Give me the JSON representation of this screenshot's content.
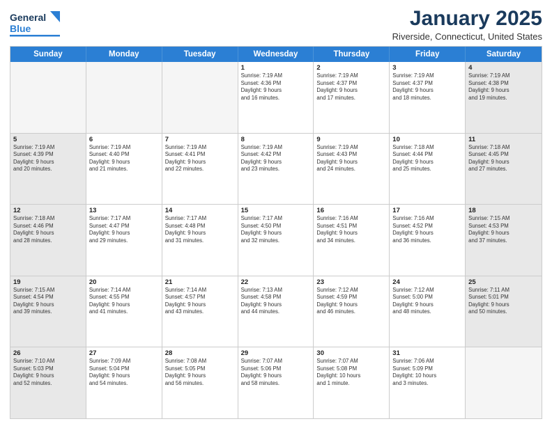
{
  "logo": {
    "line1": "General",
    "line2": "Blue"
  },
  "header": {
    "month": "January 2025",
    "location": "Riverside, Connecticut, United States"
  },
  "weekdays": [
    "Sunday",
    "Monday",
    "Tuesday",
    "Wednesday",
    "Thursday",
    "Friday",
    "Saturday"
  ],
  "weeks": [
    [
      {
        "day": "",
        "info": "",
        "empty": true
      },
      {
        "day": "",
        "info": "",
        "empty": true
      },
      {
        "day": "",
        "info": "",
        "empty": true
      },
      {
        "day": "1",
        "info": "Sunrise: 7:19 AM\nSunset: 4:36 PM\nDaylight: 9 hours\nand 16 minutes."
      },
      {
        "day": "2",
        "info": "Sunrise: 7:19 AM\nSunset: 4:37 PM\nDaylight: 9 hours\nand 17 minutes."
      },
      {
        "day": "3",
        "info": "Sunrise: 7:19 AM\nSunset: 4:37 PM\nDaylight: 9 hours\nand 18 minutes."
      },
      {
        "day": "4",
        "info": "Sunrise: 7:19 AM\nSunset: 4:38 PM\nDaylight: 9 hours\nand 19 minutes.",
        "shaded": true
      }
    ],
    [
      {
        "day": "5",
        "info": "Sunrise: 7:19 AM\nSunset: 4:39 PM\nDaylight: 9 hours\nand 20 minutes.",
        "shaded": true
      },
      {
        "day": "6",
        "info": "Sunrise: 7:19 AM\nSunset: 4:40 PM\nDaylight: 9 hours\nand 21 minutes."
      },
      {
        "day": "7",
        "info": "Sunrise: 7:19 AM\nSunset: 4:41 PM\nDaylight: 9 hours\nand 22 minutes."
      },
      {
        "day": "8",
        "info": "Sunrise: 7:19 AM\nSunset: 4:42 PM\nDaylight: 9 hours\nand 23 minutes."
      },
      {
        "day": "9",
        "info": "Sunrise: 7:19 AM\nSunset: 4:43 PM\nDaylight: 9 hours\nand 24 minutes."
      },
      {
        "day": "10",
        "info": "Sunrise: 7:18 AM\nSunset: 4:44 PM\nDaylight: 9 hours\nand 25 minutes."
      },
      {
        "day": "11",
        "info": "Sunrise: 7:18 AM\nSunset: 4:45 PM\nDaylight: 9 hours\nand 27 minutes.",
        "shaded": true
      }
    ],
    [
      {
        "day": "12",
        "info": "Sunrise: 7:18 AM\nSunset: 4:46 PM\nDaylight: 9 hours\nand 28 minutes.",
        "shaded": true
      },
      {
        "day": "13",
        "info": "Sunrise: 7:17 AM\nSunset: 4:47 PM\nDaylight: 9 hours\nand 29 minutes."
      },
      {
        "day": "14",
        "info": "Sunrise: 7:17 AM\nSunset: 4:48 PM\nDaylight: 9 hours\nand 31 minutes."
      },
      {
        "day": "15",
        "info": "Sunrise: 7:17 AM\nSunset: 4:50 PM\nDaylight: 9 hours\nand 32 minutes."
      },
      {
        "day": "16",
        "info": "Sunrise: 7:16 AM\nSunset: 4:51 PM\nDaylight: 9 hours\nand 34 minutes."
      },
      {
        "day": "17",
        "info": "Sunrise: 7:16 AM\nSunset: 4:52 PM\nDaylight: 9 hours\nand 36 minutes."
      },
      {
        "day": "18",
        "info": "Sunrise: 7:15 AM\nSunset: 4:53 PM\nDaylight: 9 hours\nand 37 minutes.",
        "shaded": true
      }
    ],
    [
      {
        "day": "19",
        "info": "Sunrise: 7:15 AM\nSunset: 4:54 PM\nDaylight: 9 hours\nand 39 minutes.",
        "shaded": true
      },
      {
        "day": "20",
        "info": "Sunrise: 7:14 AM\nSunset: 4:55 PM\nDaylight: 9 hours\nand 41 minutes."
      },
      {
        "day": "21",
        "info": "Sunrise: 7:14 AM\nSunset: 4:57 PM\nDaylight: 9 hours\nand 43 minutes."
      },
      {
        "day": "22",
        "info": "Sunrise: 7:13 AM\nSunset: 4:58 PM\nDaylight: 9 hours\nand 44 minutes."
      },
      {
        "day": "23",
        "info": "Sunrise: 7:12 AM\nSunset: 4:59 PM\nDaylight: 9 hours\nand 46 minutes."
      },
      {
        "day": "24",
        "info": "Sunrise: 7:12 AM\nSunset: 5:00 PM\nDaylight: 9 hours\nand 48 minutes."
      },
      {
        "day": "25",
        "info": "Sunrise: 7:11 AM\nSunset: 5:01 PM\nDaylight: 9 hours\nand 50 minutes.",
        "shaded": true
      }
    ],
    [
      {
        "day": "26",
        "info": "Sunrise: 7:10 AM\nSunset: 5:03 PM\nDaylight: 9 hours\nand 52 minutes.",
        "shaded": true
      },
      {
        "day": "27",
        "info": "Sunrise: 7:09 AM\nSunset: 5:04 PM\nDaylight: 9 hours\nand 54 minutes."
      },
      {
        "day": "28",
        "info": "Sunrise: 7:08 AM\nSunset: 5:05 PM\nDaylight: 9 hours\nand 56 minutes."
      },
      {
        "day": "29",
        "info": "Sunrise: 7:07 AM\nSunset: 5:06 PM\nDaylight: 9 hours\nand 58 minutes."
      },
      {
        "day": "30",
        "info": "Sunrise: 7:07 AM\nSunset: 5:08 PM\nDaylight: 10 hours\nand 1 minute."
      },
      {
        "day": "31",
        "info": "Sunrise: 7:06 AM\nSunset: 5:09 PM\nDaylight: 10 hours\nand 3 minutes."
      },
      {
        "day": "",
        "info": "",
        "empty": true,
        "shaded": true
      }
    ]
  ]
}
